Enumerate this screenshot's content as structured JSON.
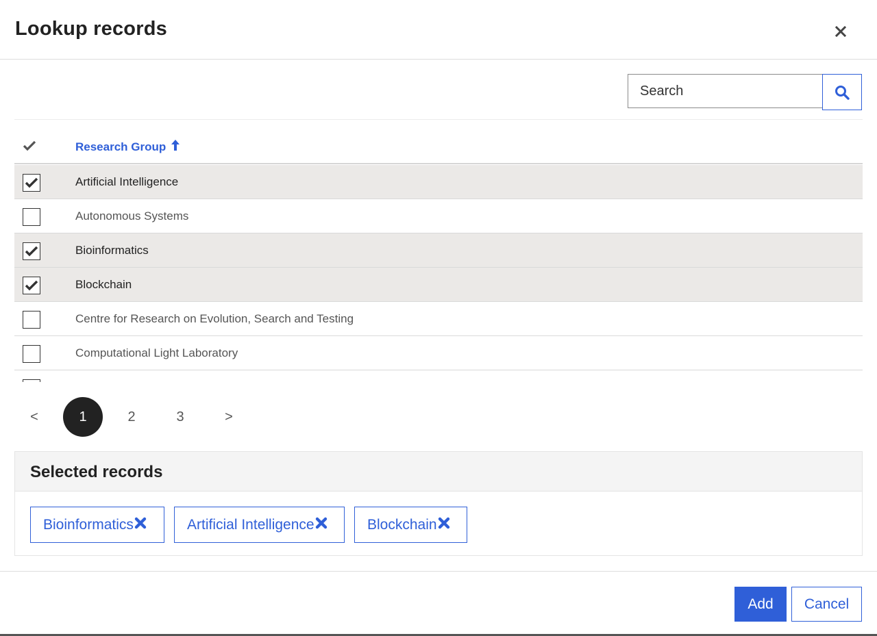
{
  "dialog": {
    "title": "Lookup records",
    "close_icon": "close-icon"
  },
  "search": {
    "placeholder": "Search",
    "value": "",
    "button_icon": "search-icon"
  },
  "table": {
    "select_column_icon": "check-icon",
    "column_header": "Research Group",
    "sort_icon": "arrow-up-icon",
    "sort_direction": "ascending",
    "rows": [
      {
        "label": "Artificial Intelligence",
        "checked": true
      },
      {
        "label": "Autonomous Systems",
        "checked": false
      },
      {
        "label": "Bioinformatics",
        "checked": true
      },
      {
        "label": "Blockchain",
        "checked": true
      },
      {
        "label": "Centre for Research on Evolution, Search and Testing",
        "checked": false
      },
      {
        "label": "Computational Light Laboratory",
        "checked": false
      }
    ]
  },
  "pagination": {
    "prev": "<",
    "pages": [
      "1",
      "2",
      "3"
    ],
    "current": "1",
    "next": ">"
  },
  "selected_records": {
    "title": "Selected records",
    "remove_icon": "remove-icon",
    "chips": [
      "Bioinformatics",
      "Artificial Intelligence",
      "Blockchain"
    ]
  },
  "footer": {
    "add_label": "Add",
    "cancel_label": "Cancel"
  },
  "colors": {
    "accent": "#2f5fd8",
    "selected_row": "#ebe9e7",
    "active_page": "#222222"
  }
}
